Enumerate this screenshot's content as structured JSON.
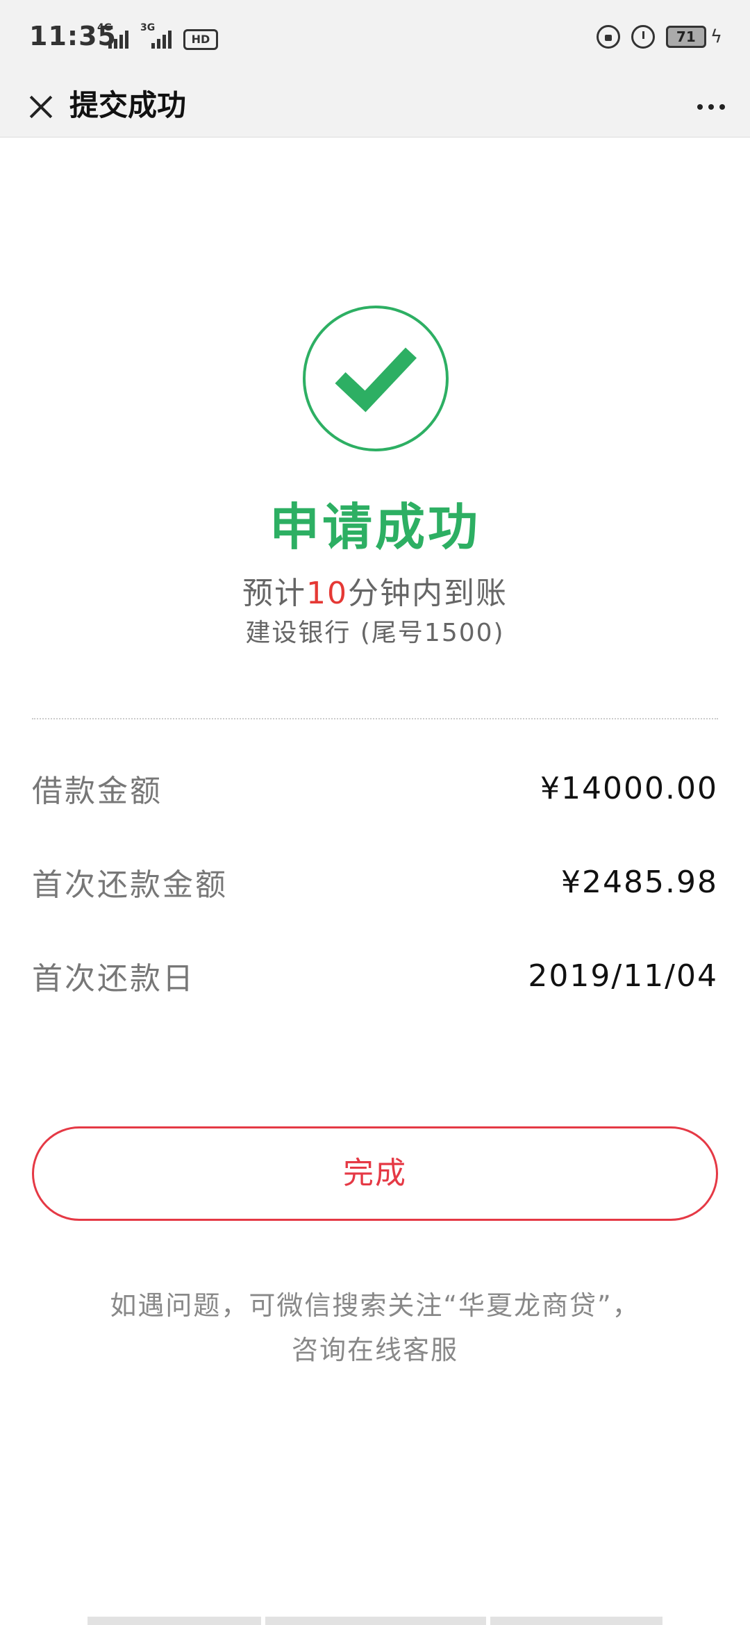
{
  "status_bar": {
    "time": "11:35",
    "network_1": "4G",
    "network_2": "3G",
    "hd": "HD",
    "battery": "71",
    "icons": [
      "signal-icon",
      "signal-icon",
      "hd-icon",
      "lock-rotation-icon",
      "alarm-icon",
      "battery-icon",
      "charging-icon"
    ]
  },
  "nav": {
    "title": "提交成功",
    "close_icon": "close-icon",
    "more_icon": "more-icon"
  },
  "result": {
    "icon": "check-circle-icon",
    "title": "申请成功",
    "eta_prefix": "预计",
    "eta_number": "10",
    "eta_suffix": "分钟内到账",
    "bank": "建设银行 (尾号1500)"
  },
  "details": [
    {
      "label": "借款金额",
      "value": "¥14000.00"
    },
    {
      "label": "首次还款金额",
      "value": "¥2485.98"
    },
    {
      "label": "首次还款日",
      "value": "2019/11/04"
    }
  ],
  "done_button": "完成",
  "help": {
    "line1": "如遇问题，可微信搜索关注“华夏龙商贷”，",
    "line2": "咨询在线客服"
  },
  "colors": {
    "success": "#2daf63",
    "accent": "#e53945",
    "highlight": "#e53935"
  }
}
